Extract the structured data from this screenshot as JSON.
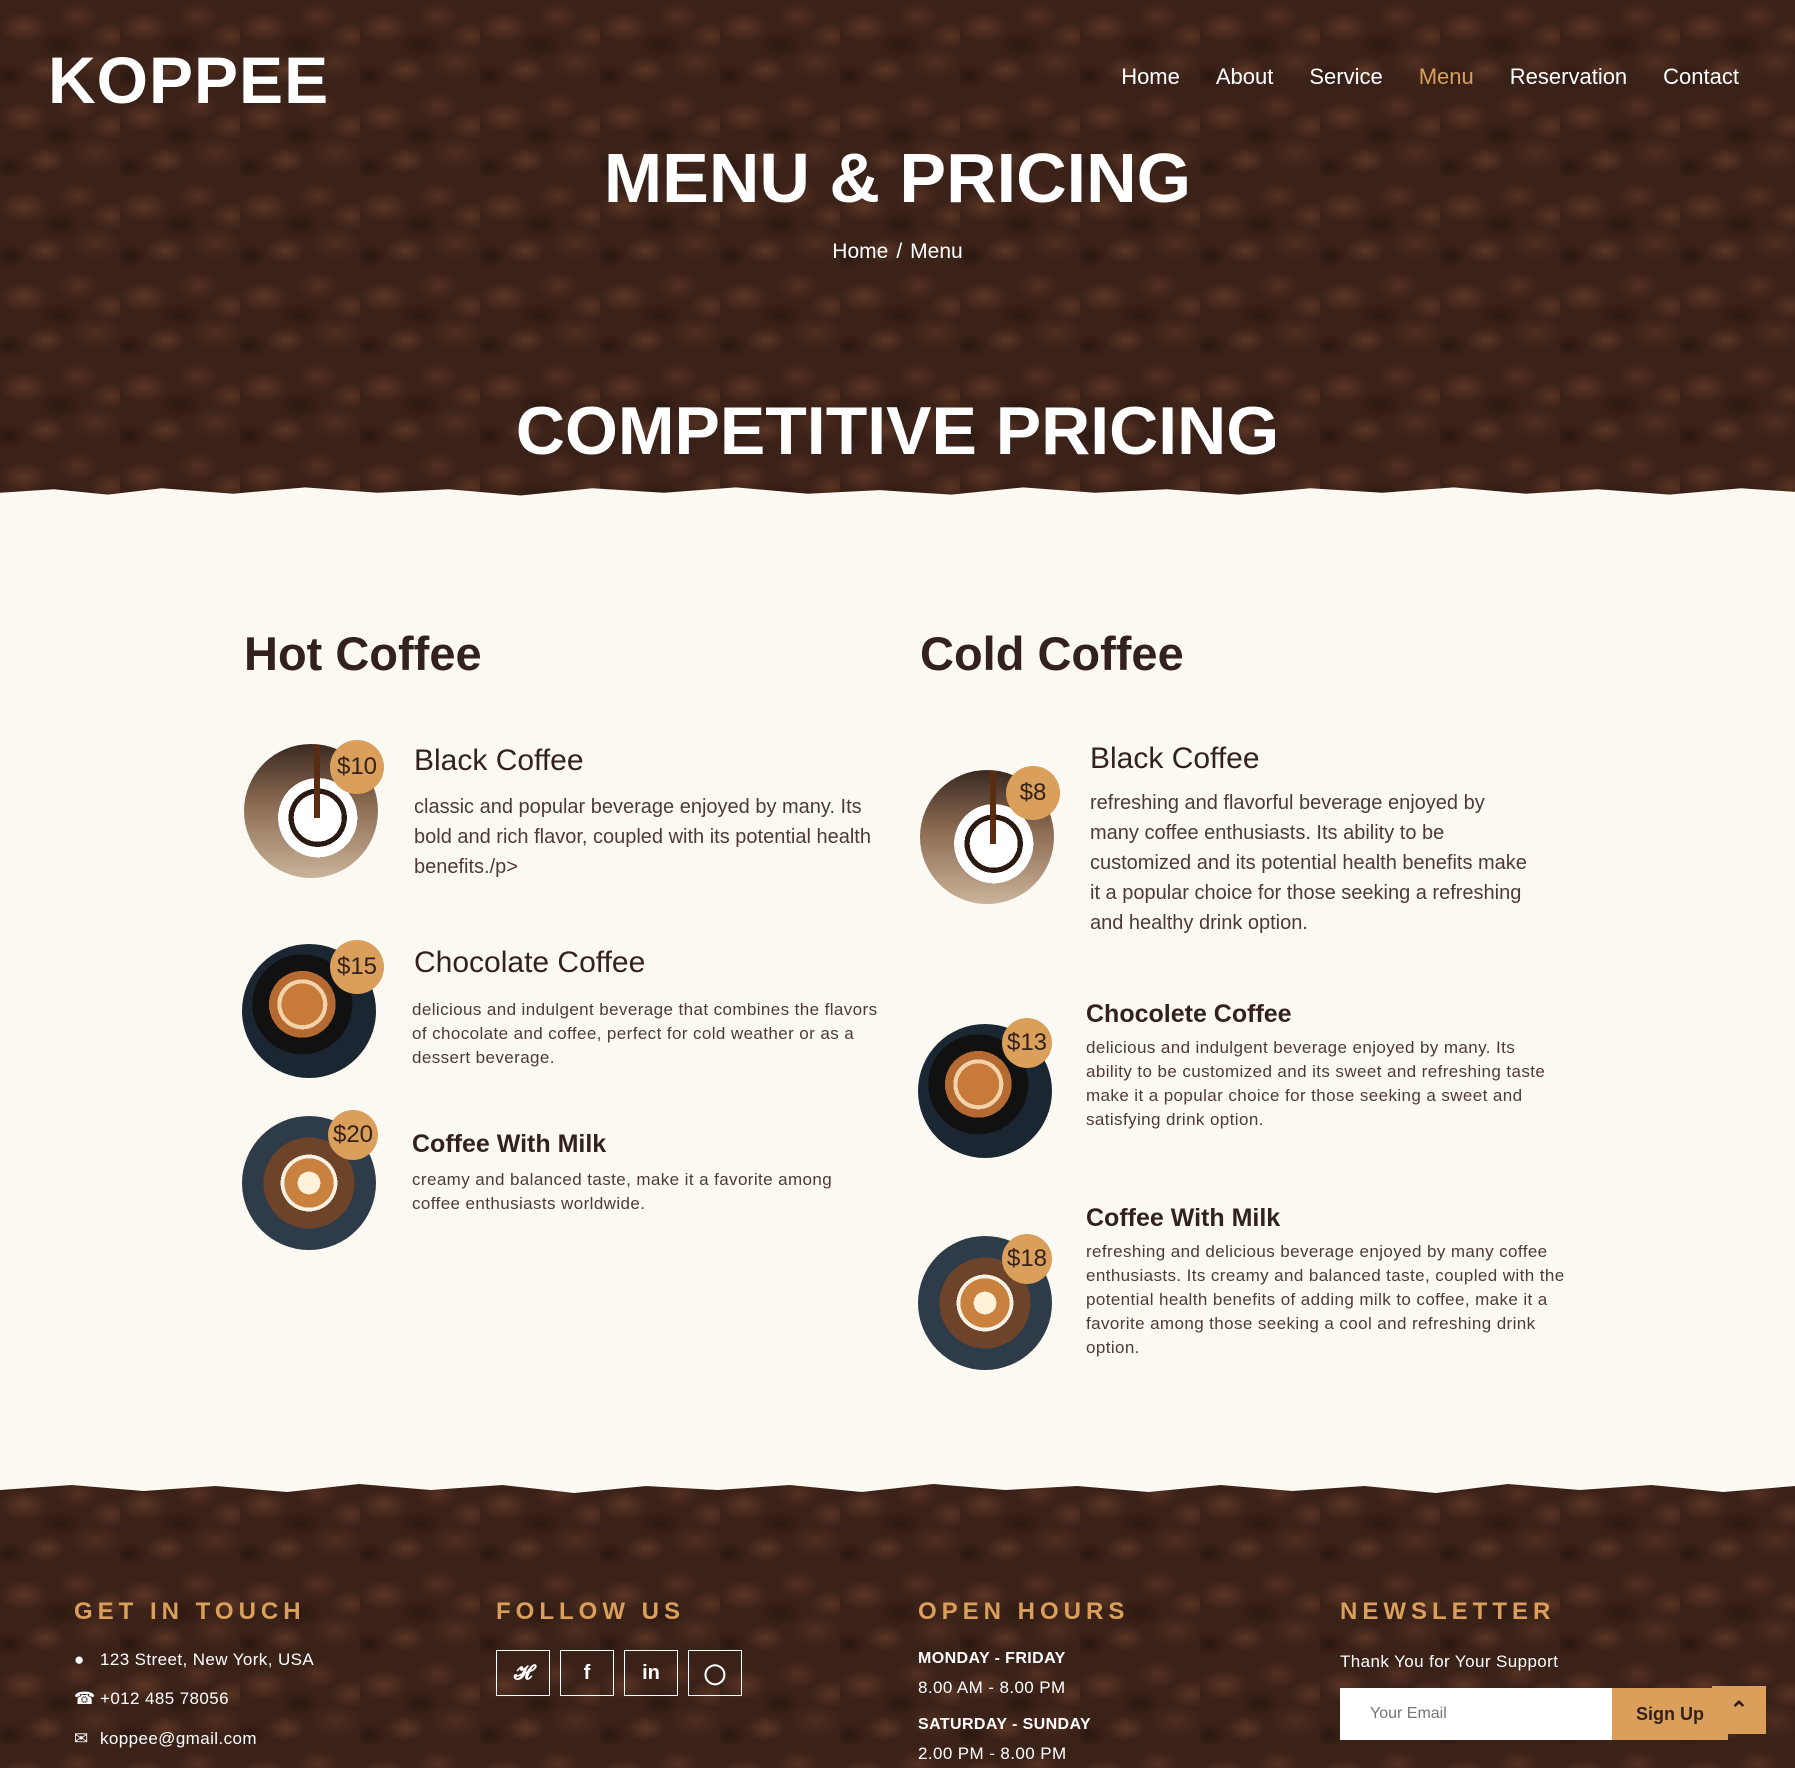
{
  "header": {
    "logo": "KOPPEE",
    "nav": [
      {
        "label": "Home",
        "active": false
      },
      {
        "label": "About",
        "active": false
      },
      {
        "label": "Service",
        "active": false
      },
      {
        "label": "Menu",
        "active": true
      },
      {
        "label": "Reservation",
        "active": false
      },
      {
        "label": "Contact",
        "active": false
      }
    ],
    "page_title": "MENU & PRICING",
    "breadcrumb": {
      "home": "Home",
      "separator": "/",
      "current": "Menu"
    },
    "section_title": "COMPETITIVE PRICING"
  },
  "menu": {
    "hot": {
      "title": "Hot Coffee",
      "items": [
        {
          "price": "$10",
          "name": "Black Coffee",
          "desc": "classic and popular beverage enjoyed by many. Its bold and rich flavor, coupled with its potential health benefits./p>"
        },
        {
          "price": "$15",
          "name": "Chocolate Coffee",
          "desc": "delicious and indulgent beverage that combines the flavors of chocolate and coffee, perfect for cold weather or as a dessert beverage."
        },
        {
          "price": "$20",
          "name": "Coffee With Milk",
          "desc": "creamy and balanced taste, make it a favorite among coffee enthusiasts worldwide."
        }
      ]
    },
    "cold": {
      "title": "Cold Coffee",
      "items": [
        {
          "price": "$8",
          "name": "Black Coffee",
          "desc": "refreshing and flavorful beverage enjoyed by many coffee enthusiasts. Its ability to be customized and its potential health benefits make it a popular choice for those seeking a refreshing and healthy drink option."
        },
        {
          "price": "$13",
          "name": "Chocolete Coffee",
          "desc": "delicious and indulgent beverage enjoyed by many. Its ability to be customized and its sweet and refreshing taste make it a popular choice for those seeking a sweet and satisfying drink option."
        },
        {
          "price": "$18",
          "name": "Coffee With Milk",
          "desc": "refreshing and delicious beverage enjoyed by many coffee enthusiasts. Its creamy and balanced taste, coupled with the potential health benefits of adding milk to coffee, make it a favorite among those seeking a cool and refreshing drink option."
        }
      ]
    }
  },
  "footer": {
    "contact": {
      "title": "GET IN TOUCH",
      "address": "123 Street, New York, USA",
      "phone": "+012 485 78056",
      "email": "koppee@gmail.com"
    },
    "follow": {
      "title": "FOLLOW US",
      "icons": [
        "twitter-icon",
        "facebook-icon",
        "linkedin-icon",
        "instagram-icon"
      ]
    },
    "hours": {
      "title": "OPEN HOURS",
      "weekday_label": "MONDAY - FRIDAY",
      "weekday_time": "8.00 AM - 8.00 PM",
      "weekend_label": "SATURDAY - SUNDAY",
      "weekend_time": "2.00 PM - 8.00 PM"
    },
    "newsletter": {
      "title": "NEWSLETTER",
      "text": "Thank You for Your Support",
      "placeholder": "Your Email",
      "button": "Sign Up"
    }
  },
  "colors": {
    "accent": "#da9f5b",
    "dark": "#33211d",
    "cream": "#fcf9f2"
  }
}
